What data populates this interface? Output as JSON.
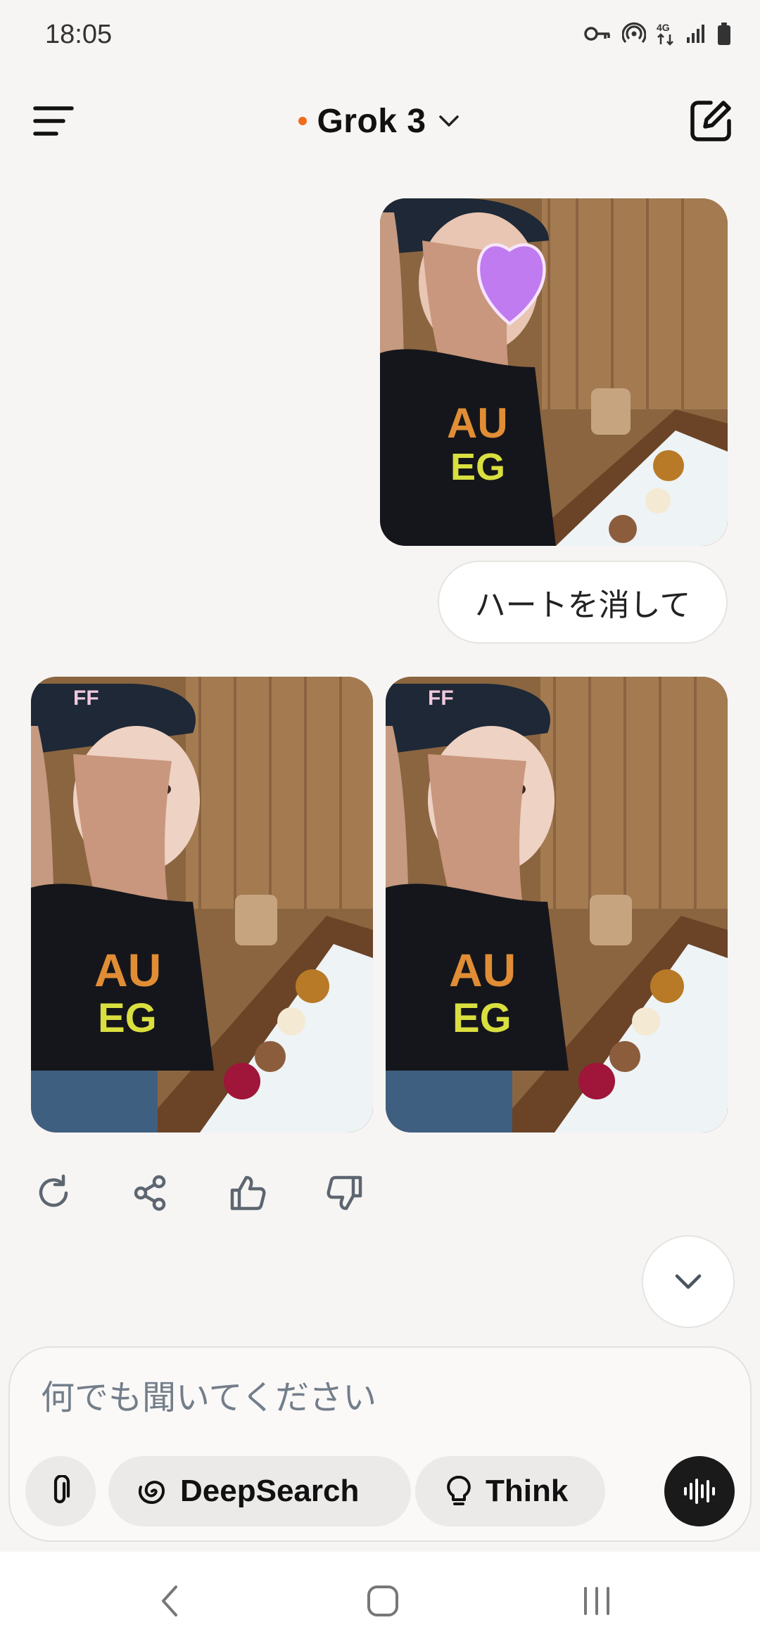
{
  "status_bar": {
    "time": "18:05",
    "network": "4G",
    "icons": [
      "key-icon",
      "hotspot-icon",
      "network-4g-icon",
      "signal-icon",
      "battery-icon"
    ]
  },
  "header": {
    "model_name": "Grok 3",
    "status_dot_color": "#f26a1b",
    "icons": [
      "menu-icon",
      "chevron-down-icon",
      "new-chat-icon"
    ]
  },
  "conversation": {
    "user_image": "uploaded-selfie-photo (heart sticker over face)",
    "user_message": "ハートを消して",
    "generated_images": [
      "edited-photo-variant-1",
      "edited-photo-variant-2"
    ],
    "actions": [
      "regenerate-icon",
      "share-icon",
      "thumbs-up-icon",
      "thumbs-down-icon"
    ]
  },
  "composer": {
    "placeholder": "何でも聞いてください",
    "deepsearch_label": "DeepSearch",
    "think_label": "Think",
    "icons": [
      "attach-icon",
      "deepsearch-icon",
      "lightbulb-icon",
      "voice-icon"
    ]
  },
  "navbar": {
    "icons": [
      "back-icon",
      "home-icon",
      "recents-icon"
    ]
  }
}
